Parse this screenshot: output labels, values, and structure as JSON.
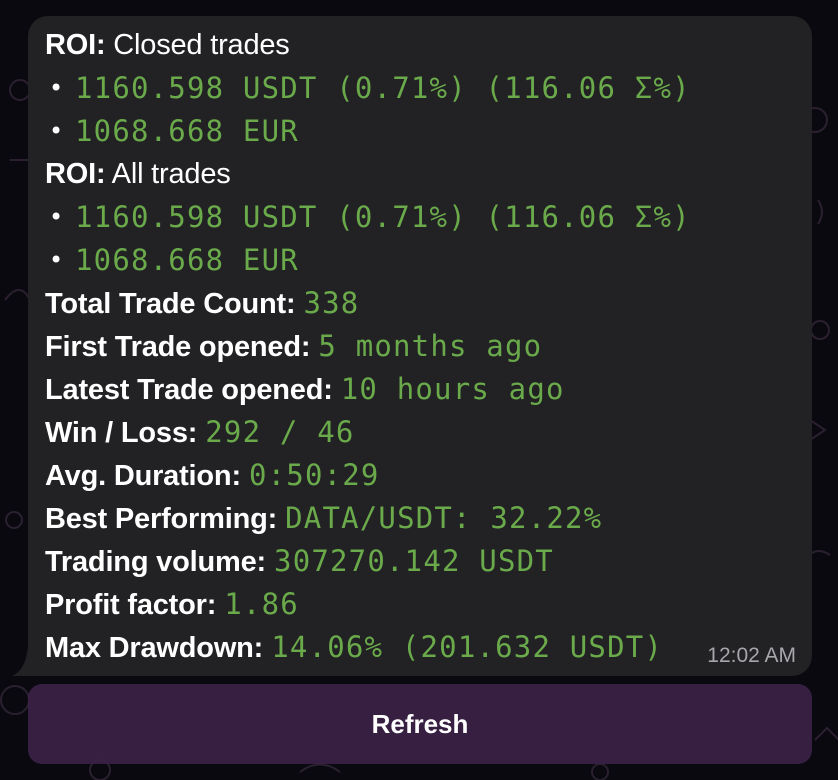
{
  "message": {
    "roi_closed_label_bold": "ROI:",
    "roi_closed_label_rest": " Closed trades",
    "roi_closed_usdt": "1160.598 USDT (0.71%) (116.06 Σ%)",
    "roi_closed_eur": "1068.668 EUR",
    "roi_all_label_bold": "ROI:",
    "roi_all_label_rest": " All trades",
    "roi_all_usdt": "1160.598 USDT (0.71%) (116.06 Σ%)",
    "roi_all_eur": "1068.668 EUR",
    "bullet": "•",
    "stats": [
      {
        "label": "Total Trade Count:",
        "value": "338"
      },
      {
        "label": "First Trade opened:",
        "value": "5 months ago"
      },
      {
        "label": "Latest Trade opened:",
        "value": "10 hours ago"
      },
      {
        "label": "Win / Loss:",
        "value": "292 / 46"
      },
      {
        "label": "Avg. Duration:",
        "value": "0:50:29"
      },
      {
        "label": "Best Performing:",
        "value": "DATA/USDT: 32.22%"
      },
      {
        "label": "Trading volume:",
        "value": "307270.142 USDT"
      },
      {
        "label": "Profit factor:",
        "value": "1.86"
      },
      {
        "label": "Max Drawdown:",
        "value": "14.06% (201.632 USDT)"
      }
    ],
    "timestamp": "12:02 AM"
  },
  "keyboard": {
    "refresh_label": "Refresh"
  },
  "colors": {
    "value_green": "#6aaa4b",
    "bubble_bg": "#222124",
    "button_bg": "#3c2246",
    "page_bg": "#0b0910"
  }
}
